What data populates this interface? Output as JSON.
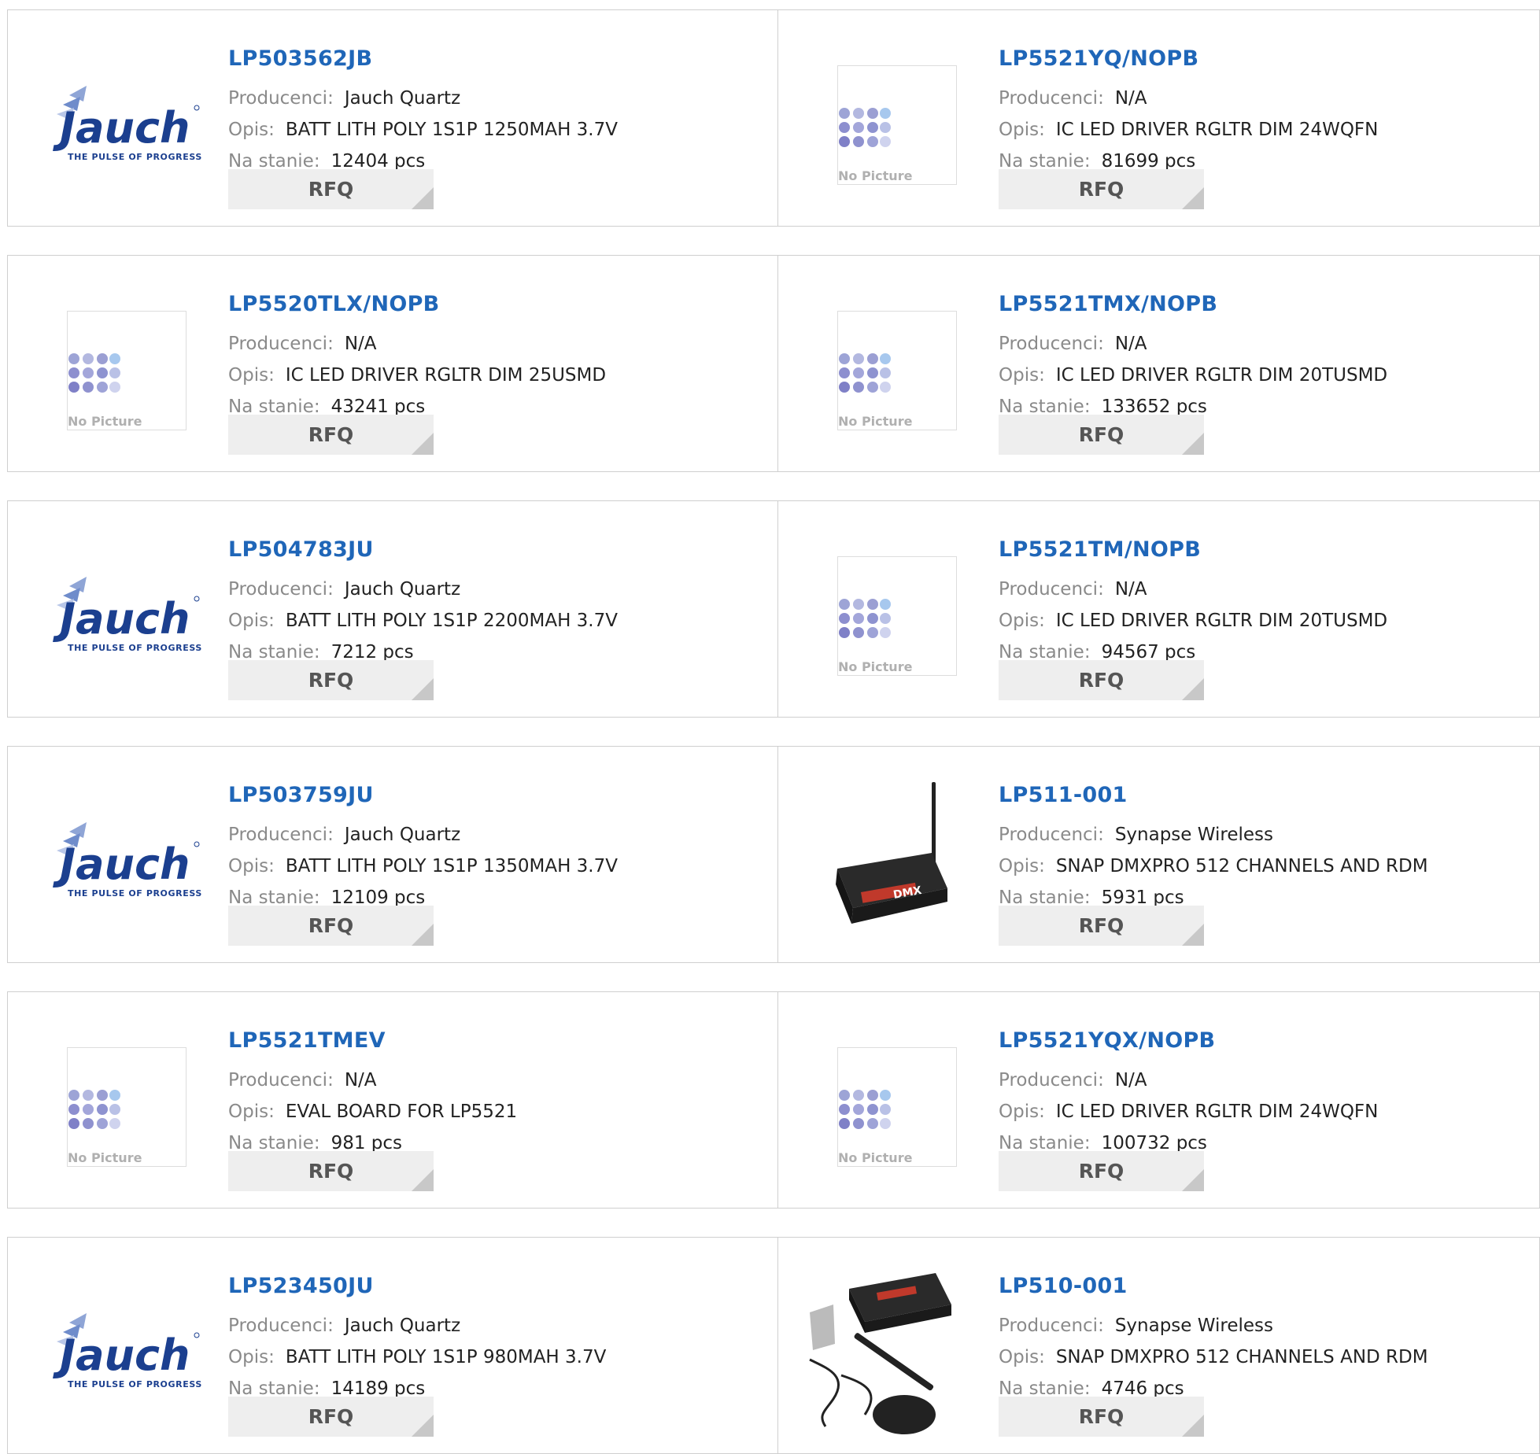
{
  "labels": {
    "manufacturer": "Producenci:",
    "description": "Opis:",
    "stock": "Na stanie:",
    "rfq": "RFQ",
    "no_picture": "No Picture",
    "jauch_brand": "Jauch",
    "jauch_tagline": "THE PULSE OF PROGRESS",
    "dmx_label": "DMX"
  },
  "colors": {
    "part_link": "#1f66b8",
    "label_gray": "#8a8a8a",
    "rfq_bg": "#eeeeee",
    "border": "#cfcfcf",
    "jauch_blue": "#1b3f8f"
  },
  "products": [
    {
      "part": "LP503562JB",
      "manufacturer": "Jauch Quartz",
      "description": "BATT LITH POLY 1S1P 1250MAH 3.7V",
      "stock": "12404 pcs",
      "image": "jauch-logo"
    },
    {
      "part": "LP5521YQ/NOPB",
      "manufacturer": "N/A",
      "description": "IC LED DRIVER RGLTR DIM 24WQFN",
      "stock": "81699 pcs",
      "image": "no-picture"
    },
    {
      "part": "LP5520TLX/NOPB",
      "manufacturer": "N/A",
      "description": "IC LED DRIVER RGLTR DIM 25USMD",
      "stock": "43241 pcs",
      "image": "no-picture"
    },
    {
      "part": "LP5521TMX/NOPB",
      "manufacturer": "N/A",
      "description": "IC LED DRIVER RGLTR DIM 20TUSMD",
      "stock": "133652 pcs",
      "image": "no-picture"
    },
    {
      "part": "LP504783JU",
      "manufacturer": "Jauch Quartz",
      "description": "BATT LITH POLY 1S1P 2200MAH 3.7V",
      "stock": "7212 pcs",
      "image": "jauch-logo"
    },
    {
      "part": "LP5521TM/NOPB",
      "manufacturer": "N/A",
      "description": "IC LED DRIVER RGLTR DIM 20TUSMD",
      "stock": "94567 pcs",
      "image": "no-picture"
    },
    {
      "part": "LP503759JU",
      "manufacturer": "Jauch Quartz",
      "description": "BATT LITH POLY 1S1P 1350MAH 3.7V",
      "stock": "12109 pcs",
      "image": "jauch-logo"
    },
    {
      "part": "LP511-001",
      "manufacturer": "Synapse Wireless",
      "description": "SNAP DMXPRO 512 CHANNELS AND RDM",
      "stock": "5931 pcs",
      "image": "dmx-device"
    },
    {
      "part": "LP5521TMEV",
      "manufacturer": "N/A",
      "description": "EVAL BOARD FOR LP5521",
      "stock": "981 pcs",
      "image": "no-picture"
    },
    {
      "part": "LP5521YQX/NOPB",
      "manufacturer": "N/A",
      "description": "IC LED DRIVER RGLTR DIM 24WQFN",
      "stock": "100732 pcs",
      "image": "no-picture"
    },
    {
      "part": "LP523450JU",
      "manufacturer": "Jauch Quartz",
      "description": "BATT LITH POLY 1S1P 980MAH 3.7V",
      "stock": "14189 pcs",
      "image": "jauch-logo"
    },
    {
      "part": "LP510-001",
      "manufacturer": "Synapse Wireless",
      "description": "SNAP DMXPRO 512 CHANNELS AND RDM",
      "stock": "4746 pcs",
      "image": "dmx-kit"
    }
  ]
}
